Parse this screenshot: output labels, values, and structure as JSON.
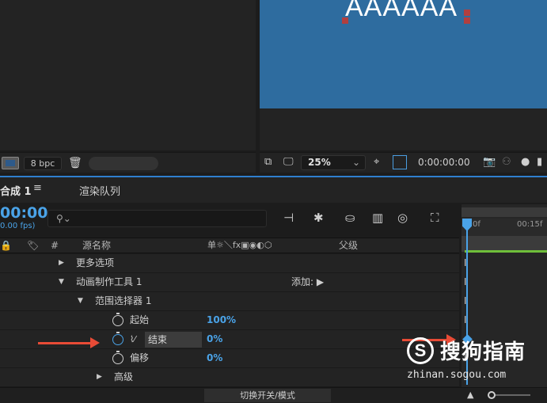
{
  "project_footer": {
    "bpc": "8 bpc"
  },
  "composition": {
    "canvas_text": "AAAAAA",
    "canvas_color": "#2e6c9f"
  },
  "comp_footer": {
    "zoom": "25%",
    "timecode": "0:00:00:00"
  },
  "timeline": {
    "tab_comp": "合成 1",
    "tab_render": "渲染队列",
    "timecode": "00:00",
    "fps": "0.00 fps)",
    "ruler_label": "00:15f",
    "ruler_zero": "0f",
    "columns": {
      "hash": "#",
      "source_name": "源名称",
      "switches": "单☼＼fx▣◉◐⬡",
      "parent": "父级"
    },
    "rows": [
      {
        "label": "更多选项"
      },
      {
        "label": "动画制作工具 1",
        "action": "添加:"
      },
      {
        "label": "范围选择器 1"
      },
      {
        "label": "起始",
        "value": "100%"
      },
      {
        "label": "结束",
        "value": "0%"
      },
      {
        "label": "偏移",
        "value": "0%"
      },
      {
        "label": "高级"
      }
    ],
    "toggle_label": "切换开关/模式"
  },
  "watermark": {
    "logo": "S",
    "name": "搜狗指南",
    "url": "zhinan.sogou.com"
  },
  "colors": {
    "accent": "#4aa3e8",
    "arrow": "#e84b36",
    "workarea": "#6fbf3a"
  }
}
